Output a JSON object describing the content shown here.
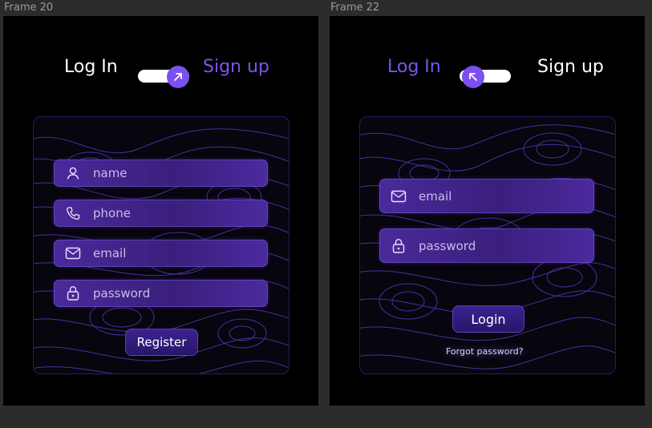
{
  "frames": [
    {
      "label": "Frame 20",
      "tabs": {
        "login": "Log In",
        "signup": "Sign up",
        "active": "signup"
      },
      "fields": [
        {
          "icon": "user-icon",
          "placeholder": "name"
        },
        {
          "icon": "phone-icon",
          "placeholder": "phone"
        },
        {
          "icon": "mail-icon",
          "placeholder": "email"
        },
        {
          "icon": "lock-icon",
          "placeholder": "password"
        }
      ],
      "button": "Register"
    },
    {
      "label": "Frame 22",
      "tabs": {
        "login": "Log In",
        "signup": "Sign up",
        "active": "login"
      },
      "fields": [
        {
          "icon": "mail-icon",
          "placeholder": "email"
        },
        {
          "icon": "lock-icon",
          "placeholder": "password"
        }
      ],
      "button": "Login",
      "forgot": "Forgot password?"
    }
  ],
  "colors": {
    "accent": "#7b54e8",
    "knob": "#7b4ff0",
    "background": "#000000",
    "canvas": "#2c2c2c"
  }
}
